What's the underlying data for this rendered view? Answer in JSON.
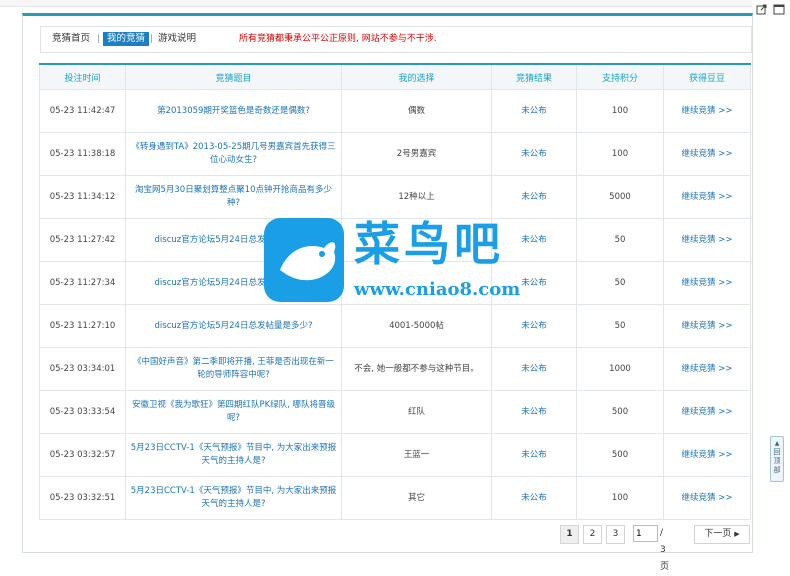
{
  "nav": {
    "tab_home": "竞猜首页",
    "tab_mine": "我的竞猜",
    "tab_help": "游戏说明",
    "separator": "|",
    "notice": "所有竞猜都秉承公平公正原则, 网站不参与不干涉."
  },
  "table": {
    "headers": [
      "投注时间",
      "竞猜题目",
      "我的选择",
      "竞猜结果",
      "支持积分",
      "获得豆豆"
    ],
    "rows": [
      {
        "time": "05-23 11:42:47",
        "subject": "第2013059期开奖篮色是奇数还是偶数?",
        "choice": "偶数",
        "result": "未公布",
        "points": "100",
        "action": "继续竞猜 >>"
      },
      {
        "time": "05-23 11:38:18",
        "subject": "《转身遇到TA》2013-05-25期几号男嘉宾首先获得三位心动女生?",
        "choice": "2号男嘉宾",
        "result": "未公布",
        "points": "100",
        "action": "继续竞猜 >>"
      },
      {
        "time": "05-23 11:34:12",
        "subject": "淘宝网5月30日聚划算整点聚10点钟开抢商品有多少种?",
        "choice": "12种以上",
        "result": "未公布",
        "points": "5000",
        "action": "继续竞猜 >>"
      },
      {
        "time": "05-23 11:27:42",
        "subject": "discuz官方论坛5月24日总发帖量是多少?",
        "choice": "",
        "result": "未公布",
        "points": "50",
        "action": "继续竞猜 >>"
      },
      {
        "time": "05-23 11:27:34",
        "subject": "discuz官方论坛5月24日总发帖量是多少?",
        "choice": "",
        "result": "未公布",
        "points": "50",
        "action": "继续竞猜 >>"
      },
      {
        "time": "05-23 11:27:10",
        "subject": "discuz官方论坛5月24日总发帖量是多少?",
        "choice": "4001-5000帖",
        "result": "未公布",
        "points": "50",
        "action": "继续竞猜 >>"
      },
      {
        "time": "05-23 03:34:01",
        "subject": "《中国好声音》第二季即将开播, 王菲是否出现在新一轮的导师阵容中呢?",
        "choice": "不会, 她一般都不参与这种节目。",
        "result": "未公布",
        "points": "1000",
        "action": "继续竞猜 >>"
      },
      {
        "time": "05-23 03:33:54",
        "subject": "安徽卫视《我为歌狂》第四期红队PK绿队, 哪队将晋级呢?",
        "choice": "红队",
        "result": "未公布",
        "points": "500",
        "action": "继续竞猜 >>"
      },
      {
        "time": "05-23 03:32:57",
        "subject": "5月23日CCTV-1《天气预报》节目中, 为大家出来预报天气的主持人是?",
        "choice": "王蓝一",
        "result": "未公布",
        "points": "500",
        "action": "继续竞猜 >>"
      },
      {
        "time": "05-23 03:32:51",
        "subject": "5月23日CCTV-1《天气预报》节目中, 为大家出来预报天气的主持人是?",
        "choice": "其它",
        "result": "未公布",
        "points": "100",
        "action": "继续竞猜 >>"
      }
    ]
  },
  "pager": {
    "pages": [
      "1",
      "2",
      "3"
    ],
    "current_page": "1",
    "jump_value": "1",
    "total": "/ 3 页",
    "next": "下一页"
  },
  "watermark": {
    "brand": "菜鸟吧",
    "url": "www.cniao8.com"
  },
  "to_top": "回顶部",
  "colors": {
    "accent": "#2a9ab4",
    "link": "#1b73b9",
    "notice": "#d60000",
    "active_tab": "#1d7fc3"
  }
}
